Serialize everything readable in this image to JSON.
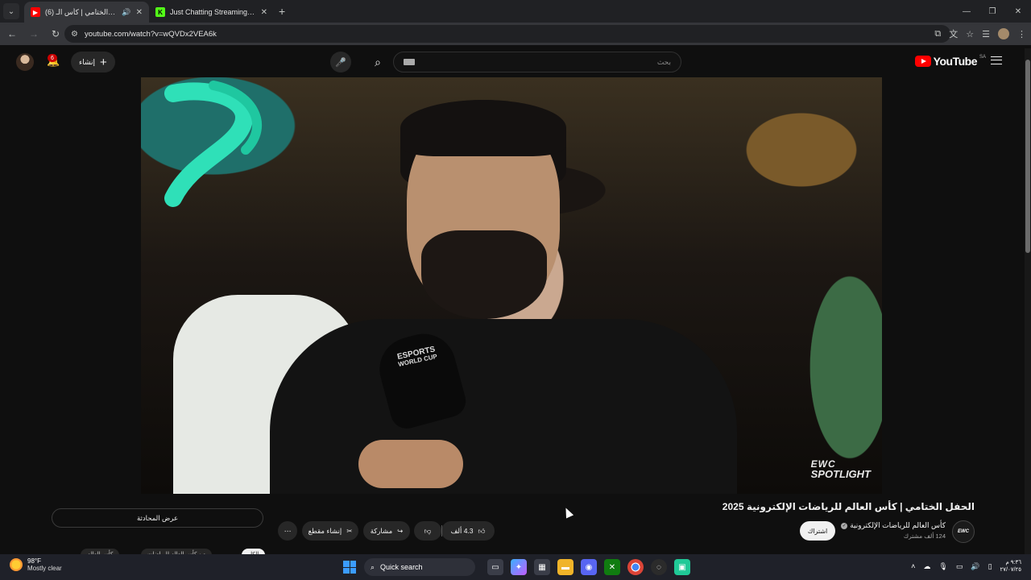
{
  "browser": {
    "tabs": [
      {
        "title": "الحفل الختامي | كأس الـ (6)",
        "favicon_color": "#ff0000",
        "active": true
      },
      {
        "title": "Just Chatting Streaming - Live",
        "favicon_color": "#53fc18",
        "active": false
      }
    ],
    "url": "youtube.com/watch?v=wQVDx2VEA6k"
  },
  "masthead": {
    "logo_text": "YouTube",
    "country_code": "SA",
    "search_placeholder": "بحث",
    "create_label": "إنشاء",
    "notification_count": "6"
  },
  "video": {
    "mic_label_line1": "ESPORTS",
    "mic_label_line2": "WORLD CUP",
    "watermark_line1": "EWC",
    "watermark_line2": "SPOTLIGHT",
    "title": "الحفل الختامي | كأس العالم للرياضات الإلكترونية 2025"
  },
  "channel": {
    "name": "كأس العالم للرياضات الإلكترونية",
    "subscribers": "124 ألف مشترك",
    "avatar_text": "EWC",
    "subscribe_label": "اشتراك"
  },
  "actions": {
    "like_count": "4.3 ألف",
    "share_label": "مشاركة",
    "clip_label": "إنشاء مقطع",
    "more_label": "⋯",
    "show_chat_label": "عرض المحادثة"
  },
  "chips": [
    {
      "label": "الكل",
      "selected": true
    },
    {
      "label": "من كأس العالم للرياضات",
      "selected": false
    },
    {
      "label": "كأس العالم",
      "selected": false
    }
  ],
  "taskbar": {
    "temperature": "98°F",
    "weather_condition": "Mostly clear",
    "search_label": "Quick search",
    "time": "٩:٣٦ م",
    "date": "٢٧/٠٧/٢٥"
  }
}
